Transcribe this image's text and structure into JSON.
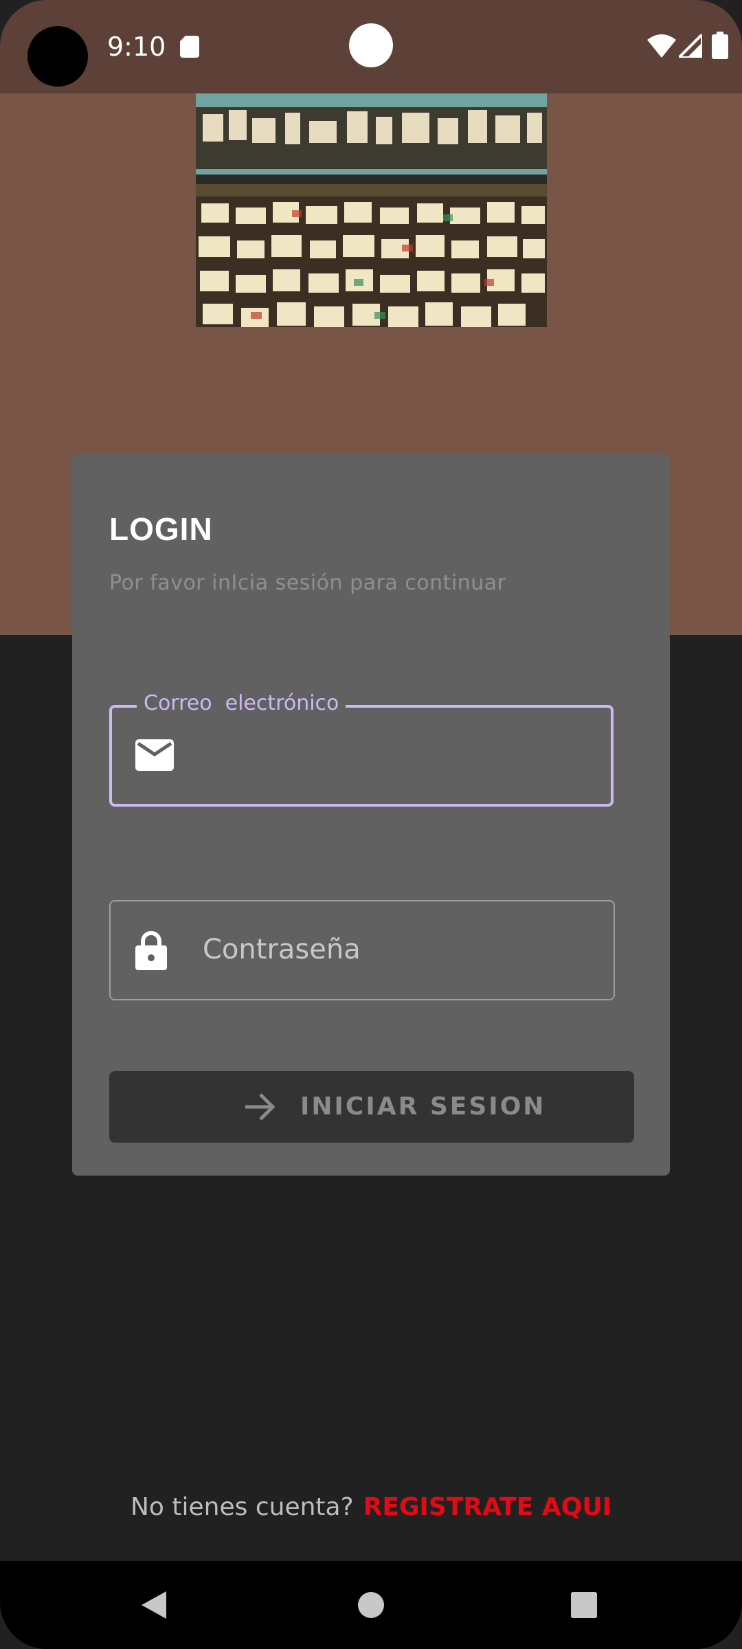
{
  "status_bar": {
    "time": "9:10",
    "icons": [
      "camera-cutout",
      "sd-card-icon",
      "wifi-icon",
      "signal-icon",
      "battery-icon"
    ]
  },
  "hero": {
    "image": "record-store-shelves-photo"
  },
  "login_card": {
    "title": "LOGIN",
    "subtitle": "Por favor inIcia sesión para continuar",
    "email_field": {
      "label": "Correo  electrónico",
      "value": "",
      "icon": "mail-icon"
    },
    "password_field": {
      "placeholder": "Contraseña",
      "value": "",
      "icon": "lock-icon"
    },
    "submit_button": {
      "label": "INICIAR SESION",
      "icon": "arrow-right-icon"
    }
  },
  "footer": {
    "question": "No tienes cuenta?",
    "register_link": "REGISTRATE AQUI"
  },
  "nav_bar": {
    "icons": [
      "back-icon",
      "home-icon",
      "recents-icon"
    ]
  },
  "colors": {
    "status_bar_bg": "#5d4037",
    "hero_bg": "#795548",
    "page_bg": "#212121",
    "card_bg": "#616161",
    "focus_accent": "#cdb8f3",
    "link_red": "#e50914",
    "button_bg": "#333333"
  }
}
